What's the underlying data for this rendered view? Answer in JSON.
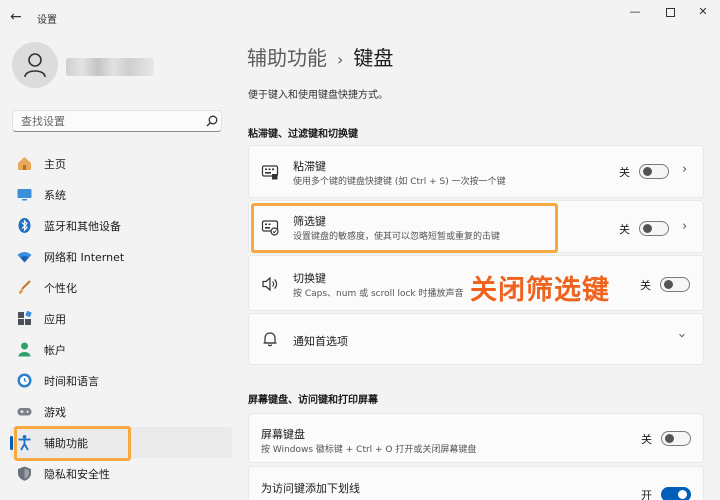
{
  "window": {
    "app_title": "设置",
    "back": "←",
    "minimize": "—",
    "close": "✕"
  },
  "profile": {
    "avatar": "person-icon"
  },
  "search": {
    "placeholder": "查找设置"
  },
  "nav": {
    "items": [
      {
        "label": "主页",
        "icon": "home-icon"
      },
      {
        "label": "系统",
        "icon": "monitor-icon"
      },
      {
        "label": "蓝牙和其他设备",
        "icon": "bluetooth-icon"
      },
      {
        "label": "网络和 Internet",
        "icon": "wifi-icon"
      },
      {
        "label": "个性化",
        "icon": "brush-icon"
      },
      {
        "label": "应用",
        "icon": "apps-icon"
      },
      {
        "label": "帐户",
        "icon": "account-icon"
      },
      {
        "label": "时间和语言",
        "icon": "globe-clock-icon"
      },
      {
        "label": "游戏",
        "icon": "gamepad-icon"
      },
      {
        "label": "辅助功能",
        "icon": "accessibility-icon",
        "active": true
      },
      {
        "label": "隐私和安全性",
        "icon": "shield-icon"
      }
    ]
  },
  "header": {
    "parent": "辅助功能",
    "separator": "›",
    "current": "键盘",
    "subtitle": "便于键入和使用键盘快捷方式。"
  },
  "sections": [
    {
      "title": "粘滞键、过滤键和切换键"
    },
    {
      "title": "屏幕键盘、访问键和打印屏幕"
    }
  ],
  "settings": {
    "sticky": {
      "title": "粘滞键",
      "desc": "使用多个键的键盘快捷键 (如 Ctrl + S) 一次按一个键",
      "state": "关",
      "icon": "sticky-keys-icon"
    },
    "filter": {
      "title": "筛选键",
      "desc": "设置键盘的敏感度，使其可以忽略短暂或重复的击键",
      "state": "关",
      "icon": "filter-keys-icon"
    },
    "toggle": {
      "title": "切换键",
      "desc": "按 Caps、num 或 scroll lock 时播放声音",
      "state": "关",
      "icon": "speaker-icon"
    },
    "notify": {
      "title": "通知首选项",
      "icon": "bell-icon"
    },
    "onscreen": {
      "title": "屏幕键盘",
      "desc": "按 Windows 徽标键 + Ctrl + O 打开或关闭屏幕键盘",
      "state": "关"
    },
    "underline": {
      "title": "为访问键添加下划线",
      "state": "开"
    }
  },
  "annotation": {
    "text": "关闭筛选键"
  },
  "colors": {
    "accent": "#005fb8",
    "highlight": "#f7a83f",
    "annotation": "#f0631f"
  }
}
